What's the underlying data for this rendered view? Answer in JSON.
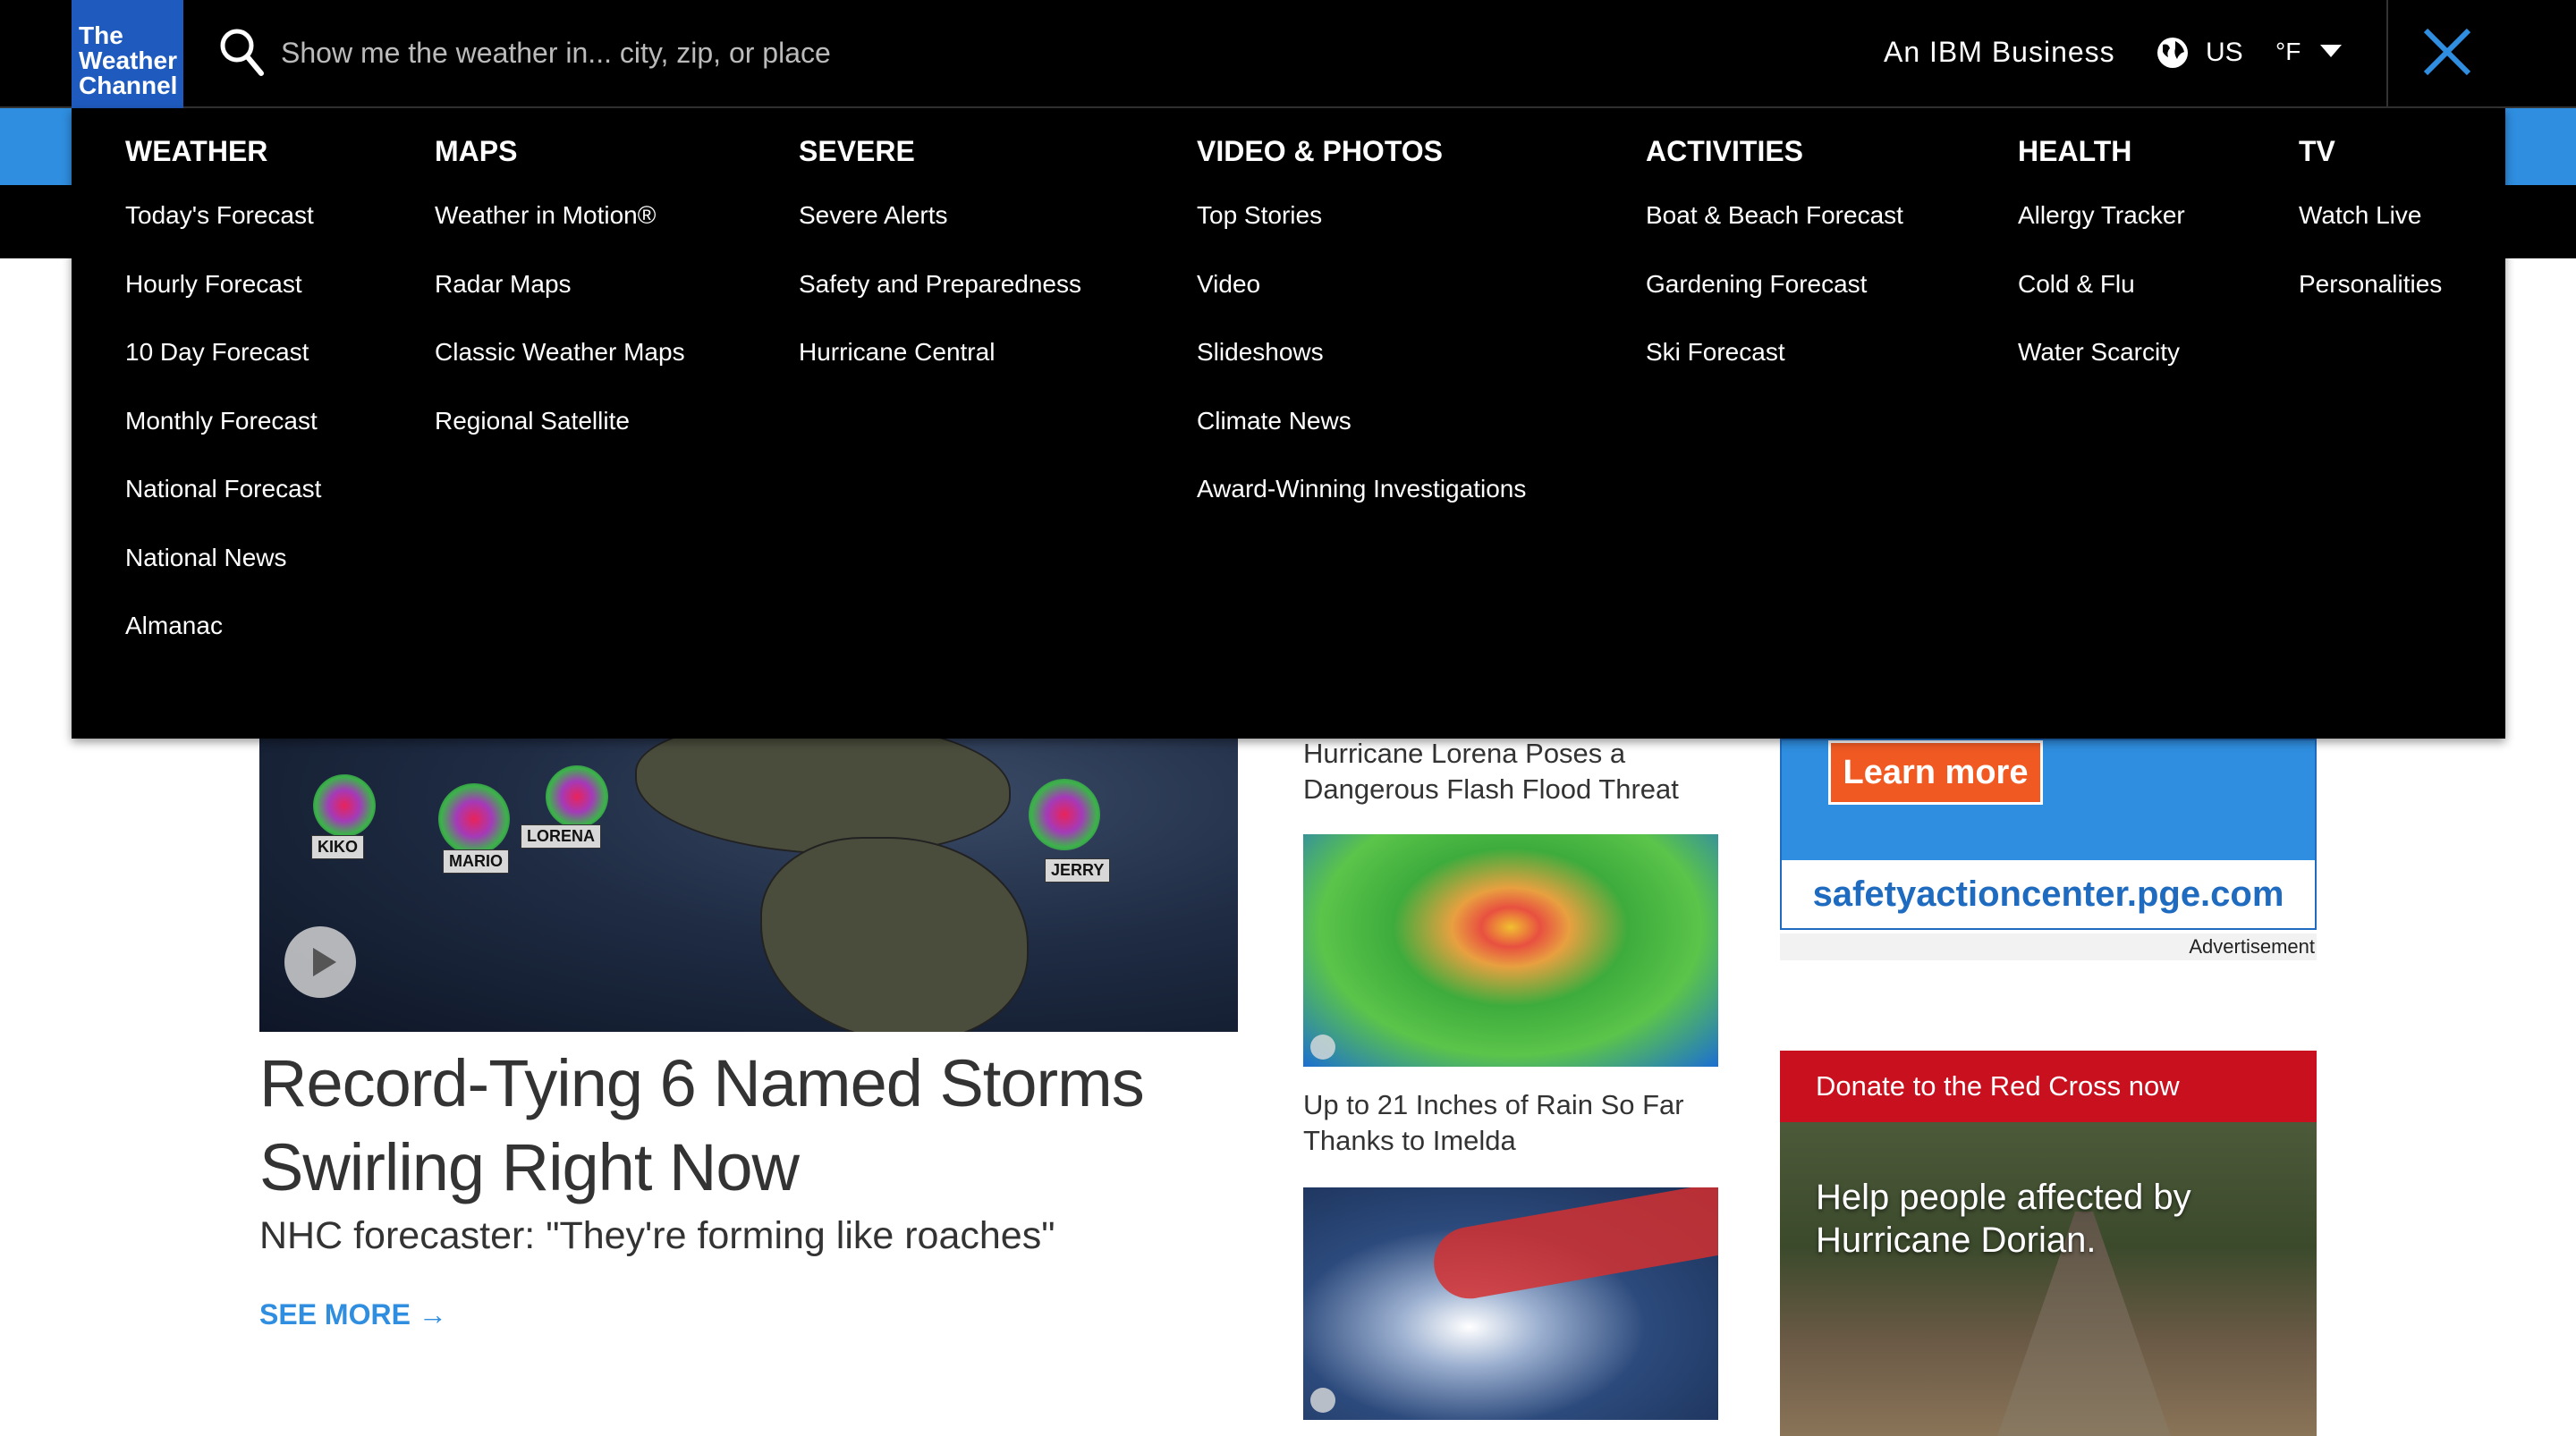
{
  "header": {
    "logo_lines": [
      "The",
      "Weather",
      "Channel"
    ],
    "search_placeholder": "Show me the weather in... city, zip, or place",
    "ibm_label": "An IBM Business",
    "country": "US",
    "unit": "°F",
    "icons": {
      "search": "search-icon",
      "globe": "globe-icon",
      "chevron": "chevron-down-icon",
      "close": "close-icon"
    },
    "close_color": "#2f8ee0"
  },
  "menu": {
    "columns": [
      {
        "heading": "WEATHER",
        "links": [
          "Today's Forecast",
          "Hourly Forecast",
          "10 Day Forecast",
          "Monthly Forecast",
          "National Forecast",
          "National News",
          "Almanac"
        ]
      },
      {
        "heading": "MAPS",
        "links": [
          "Weather in Motion®",
          "Radar Maps",
          "Classic Weather Maps",
          "Regional Satellite"
        ]
      },
      {
        "heading": "SEVERE",
        "links": [
          "Severe Alerts",
          "Safety and Preparedness",
          "Hurricane Central"
        ]
      },
      {
        "heading": "VIDEO & PHOTOS",
        "links": [
          "Top Stories",
          "Video",
          "Slideshows",
          "Climate News",
          "Award-Winning Investigations"
        ]
      },
      {
        "heading": "ACTIVITIES",
        "links": [
          "Boat & Beach Forecast",
          "Gardening Forecast",
          "Ski Forecast"
        ]
      },
      {
        "heading": "HEALTH",
        "links": [
          "Allergy Tracker",
          "Cold & Flu",
          "Water Scarcity"
        ]
      },
      {
        "heading": "TV",
        "links": [
          "Watch Live",
          "Personalities"
        ]
      }
    ]
  },
  "hero": {
    "storm_labels": [
      "KIKO",
      "MARIO",
      "LORENA",
      "JERRY"
    ],
    "title": "Record-Tying 6 Named Storms Swirling Right Now",
    "subtitle": "NHC forecaster: \"They're forming like roaches\"",
    "see_more": "SEE MORE →"
  },
  "mid_stories": [
    {
      "headline": "Hurricane Lorena Poses a Dangerous Flash Flood Threat"
    },
    {
      "headline": "Up to 21 Inches of Rain So Far Thanks to Imelda"
    }
  ],
  "ad": {
    "button": "Learn more",
    "url": "safetyactioncenter.pge.com",
    "label": "Advertisement"
  },
  "donate": {
    "header": "Donate to the Red Cross now",
    "text": "Help people affected by Hurricane Dorian."
  },
  "colors": {
    "accent_blue": "#2f8ee0",
    "logo_blue": "#1f5bbf",
    "red_cross": "#c8101f",
    "ad_orange": "#f05a22"
  }
}
